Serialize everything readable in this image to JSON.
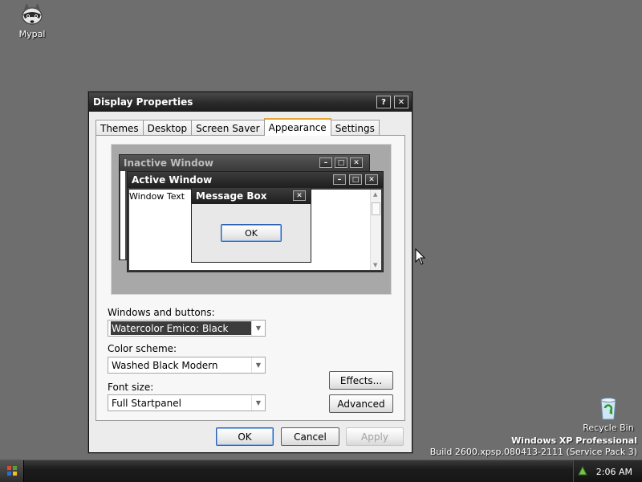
{
  "desktop": {
    "icons": [
      {
        "label": "Mypal",
        "icon": "raccoon-icon"
      },
      {
        "label": "Recycle Bin",
        "icon": "recycle-bin-icon"
      }
    ],
    "watermark": {
      "title": "Windows XP Professional",
      "build": "Build 2600.xpsp.080413-2111 (Service Pack 3)"
    }
  },
  "taskbar": {
    "start_icon": "start-menu-icon",
    "tray_icon": "network-icon",
    "clock": "2:06 AM"
  },
  "dialog": {
    "title": "Display Properties",
    "help_label": "?",
    "close_label": "✕",
    "tabs": [
      {
        "label": "Themes",
        "active": false
      },
      {
        "label": "Desktop",
        "active": false
      },
      {
        "label": "Screen Saver",
        "active": false
      },
      {
        "label": "Appearance",
        "active": true
      },
      {
        "label": "Settings",
        "active": false
      }
    ],
    "preview": {
      "inactive_title": "Inactive Window",
      "active_title": "Active Window",
      "window_text": "Window Text",
      "message_box_title": "Message Box",
      "message_ok": "OK"
    },
    "windows_and_buttons": {
      "label": "Windows and buttons:",
      "value": "Watercolor Emico: Black"
    },
    "color_scheme": {
      "label": "Color scheme:",
      "value": "Washed Black Modern"
    },
    "font_size": {
      "label": "Font size:",
      "value": "Full Startpanel"
    },
    "effects_label": "Effects...",
    "advanced_label": "Advanced",
    "ok_label": "OK",
    "cancel_label": "Cancel",
    "apply_label": "Apply"
  }
}
